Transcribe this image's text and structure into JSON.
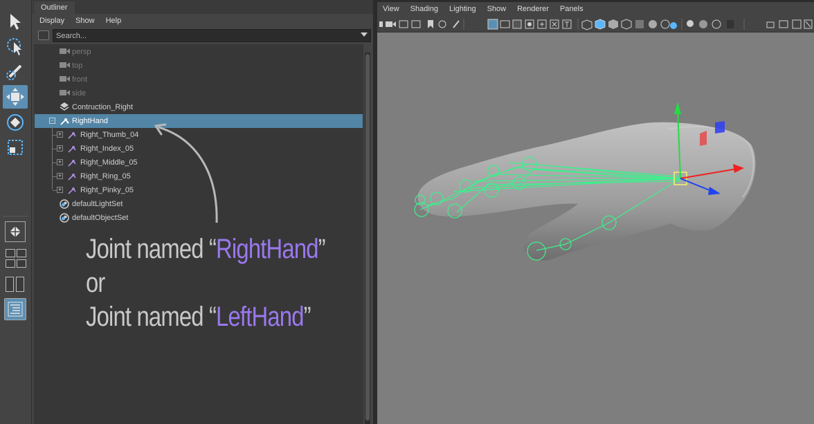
{
  "outliner": {
    "tab_label": "Outliner",
    "menu": [
      "Display",
      "Show",
      "Help"
    ],
    "search_placeholder": "Search...",
    "items": [
      {
        "label": "persp",
        "kind": "camera",
        "dim": true
      },
      {
        "label": "top",
        "kind": "camera",
        "dim": true
      },
      {
        "label": "front",
        "kind": "camera",
        "dim": true
      },
      {
        "label": "side",
        "kind": "camera",
        "dim": true
      },
      {
        "label": "Contruction_Right",
        "kind": "transform",
        "dim": false
      },
      {
        "label": "RightHand",
        "kind": "joint",
        "dim": false,
        "selected": true
      },
      {
        "label": "Right_Thumb_04",
        "kind": "joint",
        "dim": false
      },
      {
        "label": "Right_Index_05",
        "kind": "joint",
        "dim": false
      },
      {
        "label": "Right_Middle_05",
        "kind": "joint",
        "dim": false
      },
      {
        "label": "Right_Ring_05",
        "kind": "joint",
        "dim": false
      },
      {
        "label": "Right_Pinky_05",
        "kind": "joint",
        "dim": false
      },
      {
        "label": "defaultLightSet",
        "kind": "set",
        "dim": false
      },
      {
        "label": "defaultObjectSet",
        "kind": "set",
        "dim": false
      }
    ]
  },
  "annotation": {
    "line1_prefix": "Joint named “",
    "line1_name": "RightHand",
    "line1_suffix": "”",
    "line2": "or",
    "line3_prefix": "Joint named “",
    "line3_name": "LeftHand",
    "line3_suffix": "”"
  },
  "viewport": {
    "menu": [
      "View",
      "Shading",
      "Lighting",
      "Show",
      "Renderer",
      "Panels"
    ]
  },
  "toolbox": {
    "tools": [
      "select-tool-icon",
      "lasso-tool-icon",
      "paint-select-tool-icon",
      "move-tool-icon",
      "rotate-tool-icon",
      "scale-tool-icon"
    ]
  },
  "colors": {
    "selection": "#5285a6",
    "annotation_highlight": "#9a78ee",
    "joint_green": "#3cf08c",
    "viewport_bg": "#7e7e7e"
  }
}
